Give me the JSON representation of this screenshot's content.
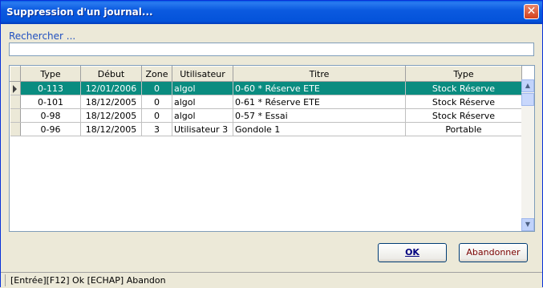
{
  "window": {
    "title": "Suppression d'un journal...",
    "close_glyph": "✕"
  },
  "search": {
    "label": "Rechercher ...",
    "value": ""
  },
  "grid": {
    "columns": [
      "Type",
      "Début",
      "Zone",
      "Utilisateur",
      "Titre",
      "Type"
    ],
    "rows": [
      [
        "0-113",
        "12/01/2006",
        "0",
        "algol",
        "0-60 * Réserve ETE",
        "Stock Réserve"
      ],
      [
        "0-101",
        "18/12/2005",
        "0",
        "algol",
        "0-61 * Réserve ETE",
        "Stock Réserve"
      ],
      [
        "0-98",
        "18/12/2005",
        "0",
        "algol",
        "0-57 * Essai",
        "Stock Réserve"
      ],
      [
        "0-96",
        "18/12/2005",
        "3",
        "Utilisateur 3",
        "Gondole 1",
        "Portable"
      ]
    ],
    "selected_row": 0
  },
  "buttons": {
    "ok": "OK",
    "cancel": "Abandonner"
  },
  "status": {
    "text": "[Entrée][F12] Ok  [ECHAP] Abandon"
  },
  "colors": {
    "selection": "#0a8c80",
    "titlebar": "#0453da"
  }
}
